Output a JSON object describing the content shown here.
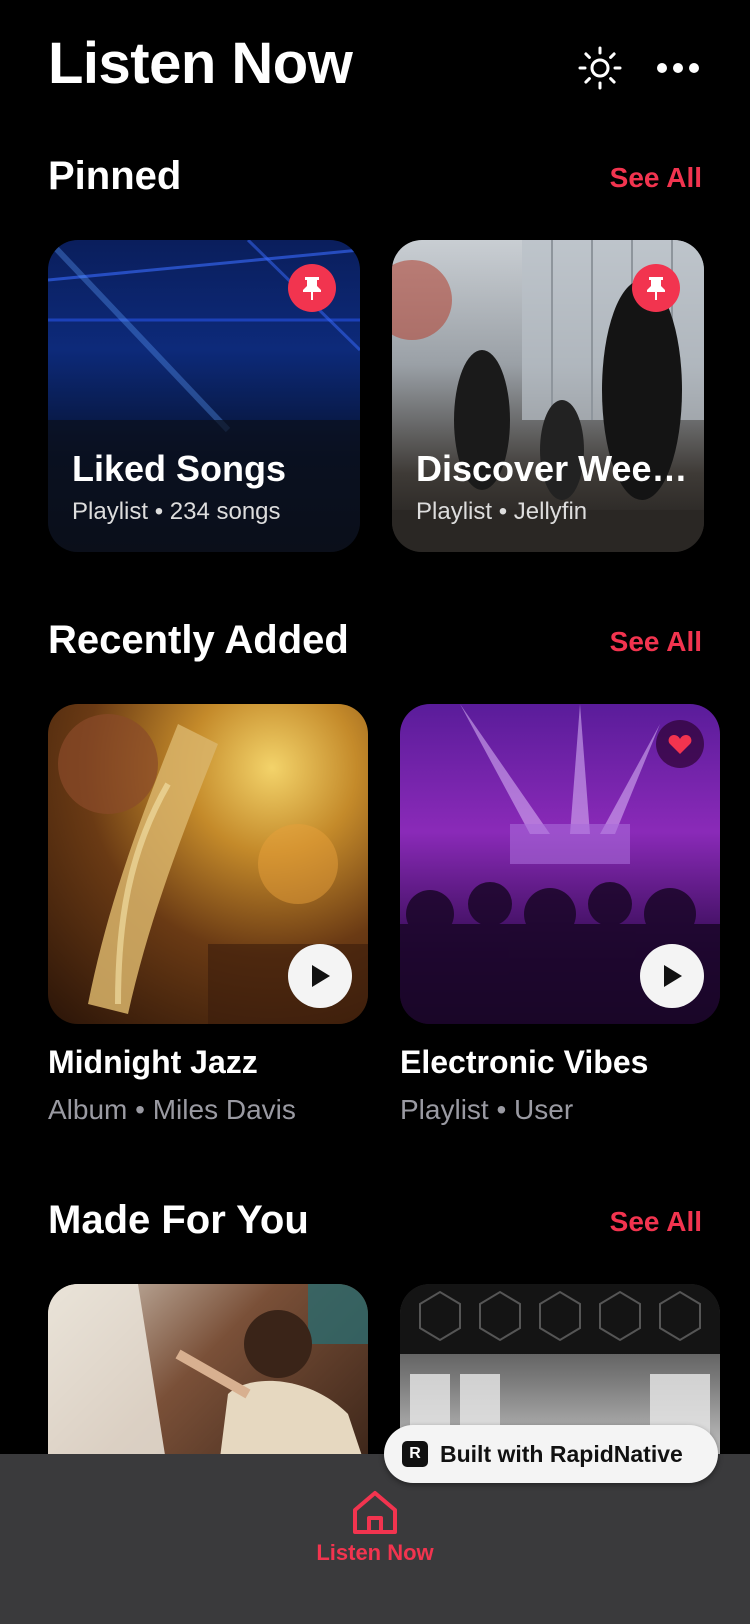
{
  "header": {
    "title": "Listen Now"
  },
  "pinned": {
    "title": "Pinned",
    "see_all": "See All",
    "items": [
      {
        "title": "Liked Songs",
        "subtitle": "Playlist • 234 songs"
      },
      {
        "title": "Discover Weekly",
        "subtitle": "Playlist • Jellyfin"
      }
    ]
  },
  "recent": {
    "title": "Recently Added",
    "see_all": "See All",
    "items": [
      {
        "title": "Midnight Jazz",
        "subtitle": "Album • Miles Davis"
      },
      {
        "title": "Electronic Vibes",
        "subtitle": "Playlist • User"
      }
    ]
  },
  "made": {
    "title": "Made For You",
    "see_all": "See All"
  },
  "tabbar": {
    "tabs": [
      {
        "label": "Listen Now"
      }
    ]
  },
  "badge": {
    "label": "Built with RapidNative"
  },
  "colors": {
    "accent": "#f2344f",
    "background": "#000000",
    "tabbar": "#3a3a3c"
  }
}
